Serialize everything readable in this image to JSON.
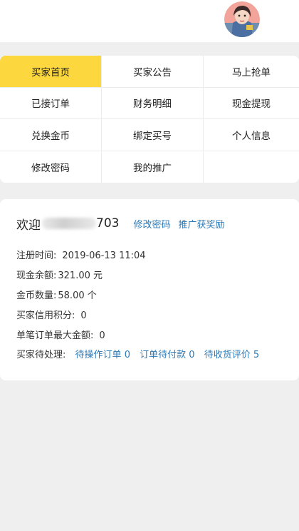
{
  "menu": [
    {
      "label": "买家首页",
      "active": true
    },
    {
      "label": "买家公告"
    },
    {
      "label": "马上抢单"
    },
    {
      "label": "已接订单"
    },
    {
      "label": "财务明细"
    },
    {
      "label": "现金提现"
    },
    {
      "label": "兑换金币"
    },
    {
      "label": "绑定买号"
    },
    {
      "label": "个人信息"
    },
    {
      "label": "修改密码"
    },
    {
      "label": "我的推广"
    }
  ],
  "user": {
    "welcome": "欢迎",
    "name_suffix": "703",
    "change_password": "修改密码",
    "referral": "推广获奖励"
  },
  "info": {
    "register_label": "注册时间:",
    "register_value": "2019-06-13 11:04",
    "cash_label": "现金余额:",
    "cash_value": "321.00",
    "cash_unit": "元",
    "coin_label": "金币数量:",
    "coin_value": "58.00",
    "coin_unit": "个",
    "credit_label": "买家信用积分:",
    "credit_value": "0",
    "max_label": "单笔订单最大金额:",
    "max_value": "0",
    "pending_label": "买家待处理:",
    "pending": [
      {
        "label": "待操作订单",
        "count": "0"
      },
      {
        "label": "订单待付款",
        "count": "0"
      },
      {
        "label": "待收货评价",
        "count": "5"
      }
    ]
  },
  "colors": {
    "accent": "#fcd73d",
    "link": "#2e7ab7",
    "money": "#e03030",
    "background": "#efefef"
  }
}
